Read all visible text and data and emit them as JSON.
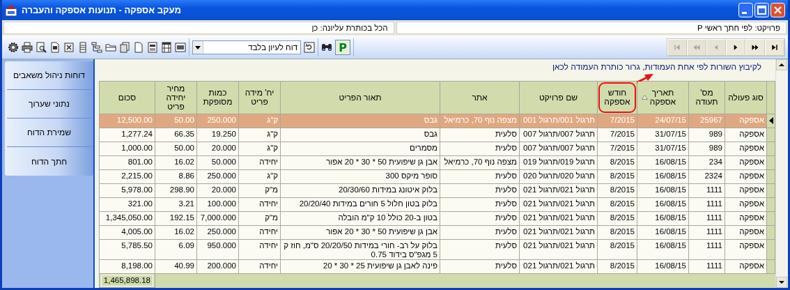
{
  "window": {
    "title": "מעקב אספקה - תנועות אספקה והעברה"
  },
  "info_bar": [
    {
      "text": "פרויקט: לפי חתך ראשי P"
    },
    {
      "text": "הכל בכותרת עליונה: כן"
    }
  ],
  "toolbar": {
    "report_mode": "דוח לעיון בלבד",
    "p_button": {
      "label": "P",
      "selected": true
    },
    "nav": [
      {
        "kind": "first",
        "disabled": true
      },
      {
        "kind": "prev_page",
        "disabled": true
      },
      {
        "kind": "prev",
        "disabled": true
      },
      {
        "kind": "next",
        "disabled": false
      },
      {
        "kind": "next_page",
        "disabled": false
      },
      {
        "kind": "last",
        "disabled": false
      }
    ]
  },
  "sidebar": {
    "items": [
      {
        "label": "דוחות ניהול משאבים"
      },
      {
        "label": "נתוני שערוך"
      },
      {
        "label": "שמירת הדוח"
      },
      {
        "label": "חתך הדוח"
      }
    ]
  },
  "grid": {
    "group_hint": "לקיבוץ השורות לפי אחת העמודות, גרור כותרת העמודה לכאן",
    "columns": [
      {
        "label": "סוג פעולה",
        "sorted": false,
        "circled": false
      },
      {
        "label": "מס'\nתעודה",
        "sorted": false,
        "circled": false
      },
      {
        "label": "תאריך\nאספקה",
        "sorted": true,
        "circled": false
      },
      {
        "label": "חודש\nאספקה",
        "sorted": false,
        "circled": true
      },
      {
        "label": "שם פרויקט",
        "sorted": false,
        "circled": false
      },
      {
        "label": "אתר",
        "sorted": false,
        "circled": false
      },
      {
        "label": "תאור הפריט",
        "sorted": false,
        "circled": false
      },
      {
        "label": "יח' מידה\nפריט",
        "sorted": false,
        "circled": false
      },
      {
        "label": "כמות\nמסופקת",
        "sorted": false,
        "circled": false
      },
      {
        "label": "מחיר\nיחידה\nפריט",
        "sorted": false,
        "circled": false
      },
      {
        "label": "סכום",
        "sorted": false,
        "circled": false
      }
    ],
    "rows": [
      {
        "selected": true,
        "cells": [
          "אספקה",
          "25967",
          "24/07/15",
          "7/2015",
          "תרגול 001/תרגול 001",
          "מצפה נוף 70, כרמיאל",
          "גבס",
          "ק\"ג",
          "250.000",
          "50.00",
          "12,500.00"
        ]
      },
      {
        "selected": false,
        "cells": [
          "אספקה",
          "989",
          "31/07/15",
          "7/2015",
          "תרגול 007/תרגול 007",
          "סלעית",
          "גבס",
          "ק\"ג",
          "19.250",
          "66.35",
          "1,277.24"
        ]
      },
      {
        "selected": false,
        "cells": [
          "אספקה",
          "989",
          "31/07/15",
          "7/2015",
          "תרגול 007/תרגול 007",
          "סלעית",
          "מסמרים",
          "ק\"ג",
          "20.000",
          "50.00",
          "1,000.00"
        ]
      },
      {
        "selected": false,
        "cells": [
          "אספקה",
          "234",
          "16/08/15",
          "8/2015",
          "תרגול 019/תרגול 019",
          "מצפה נוף 70, כרמיאל",
          "אבן גן שיפועית 50 * 30 * 20 אפור",
          "יחידה",
          "50.000",
          "16.02",
          "801.00"
        ]
      },
      {
        "selected": false,
        "cells": [
          "אספקה",
          "2324",
          "16/08/15",
          "8/2015",
          "תרגול 020/תרגול 020",
          "סלעית",
          "סופר מיקס 300",
          "ק\"ג",
          "250.000",
          "8.86",
          "2,215.00"
        ]
      },
      {
        "selected": false,
        "cells": [
          "אספקה",
          "1111",
          "16/08/15",
          "8/2015",
          "תרגול 021/תרגול 021",
          "סלעית",
          "בלוק איטונג במידות 20/30/60",
          "מ\"ק",
          "20.000",
          "298.90",
          "5,978.00"
        ]
      },
      {
        "selected": false,
        "cells": [
          "אספקה",
          "1111",
          "16/08/15",
          "8/2015",
          "תרגול 021/תרגול 021",
          "סלעית",
          "בלוק בטון חלול 5 חורים במידות 20/20/40",
          "יחידה",
          "100.000",
          "3.21",
          "321.00"
        ]
      },
      {
        "selected": false,
        "cells": [
          "אספקה",
          "1111",
          "16/08/15",
          "8/2015",
          "תרגול 021/תרגול 021",
          "סלעית",
          "בטון ב-20 כולל 10 ק\"מ הובלה",
          "מ\"ק",
          "7,000.000",
          "192.15",
          "1,345,050.00"
        ]
      },
      {
        "selected": false,
        "cells": [
          "אספקה",
          "1111",
          "16/08/15",
          "8/2015",
          "תרגול 021/תרגול 021",
          "סלעית",
          "אבן גן שיפועית 50 * 30 * 20 אפור",
          "יחידה",
          "250.000",
          "16.02",
          "4,005.00"
        ]
      },
      {
        "selected": false,
        "cells": [
          "אספקה",
          "1111",
          "16/08/15",
          "8/2015",
          "תרגול 021/תרגול 021",
          "סלעית",
          "בלוק על רב- חורי במידות 20/20/50 ס\"מ, חוז ק 5 מגפ\"ס בידוד 0.75",
          "יחידה",
          "950.000",
          "6.09",
          "5,785.50"
        ]
      },
      {
        "selected": false,
        "cells": [
          "אספקה",
          "1111",
          "16/08/15",
          "8/2015",
          "תרגול 021/תרגול 021",
          "סלעית",
          "פינה לאבן גן שיפועית 25 * 30 * 20",
          "יחידה",
          "200.000",
          "40.99",
          "8,198.00"
        ]
      }
    ],
    "total": "1,465,898.18"
  }
}
